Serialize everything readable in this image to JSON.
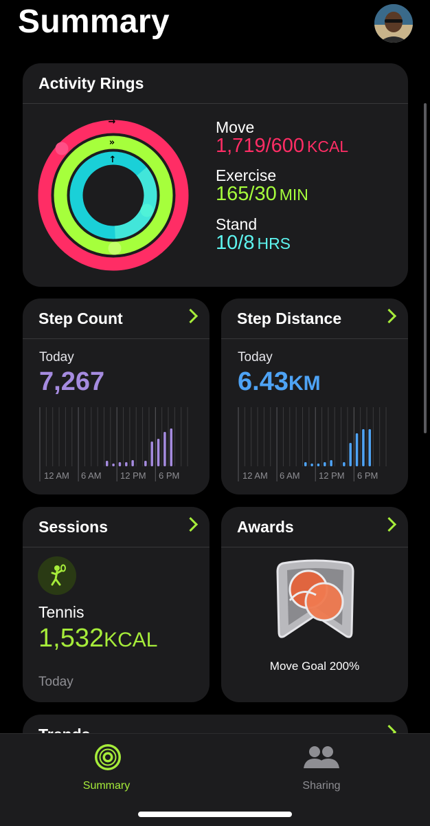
{
  "header": {
    "title": "Summary"
  },
  "activity": {
    "title": "Activity Rings",
    "move": {
      "label": "Move",
      "value": "1,719/600",
      "unit": "KCAL",
      "color": "#ff2d65",
      "progress": 2.87
    },
    "exercise": {
      "label": "Exercise",
      "value": "165/30",
      "unit": "MIN",
      "color": "#a6ff3c",
      "progress": 5.5
    },
    "stand": {
      "label": "Stand",
      "value": "10/8",
      "unit": "HRS",
      "color": "#00f0e0",
      "progress": 1.25
    }
  },
  "steps": {
    "title": "Step Count",
    "today_label": "Today",
    "value": "7,267",
    "color": "#a58bdf",
    "axis": [
      "12 AM",
      "6 AM",
      "12 PM",
      "6 PM"
    ]
  },
  "distance": {
    "title": "Step Distance",
    "today_label": "Today",
    "value": "6.43",
    "unit": "KM",
    "color": "#4ea3f5",
    "axis": [
      "12 AM",
      "6 AM",
      "12 PM",
      "6 PM"
    ]
  },
  "sessions": {
    "title": "Sessions",
    "workout": "Tennis",
    "value": "1,532",
    "unit": "KCAL",
    "when": "Today",
    "icon": "tennis-icon"
  },
  "awards": {
    "title": "Awards",
    "badge_label": "Move Goal 200%",
    "icon": "move-goal-award-icon"
  },
  "trends": {
    "title": "Trends"
  },
  "tabbar": {
    "summary_label": "Summary",
    "sharing_label": "Sharing",
    "active_color": "#a6ec3a",
    "inactive_color": "#8e8e93"
  }
}
